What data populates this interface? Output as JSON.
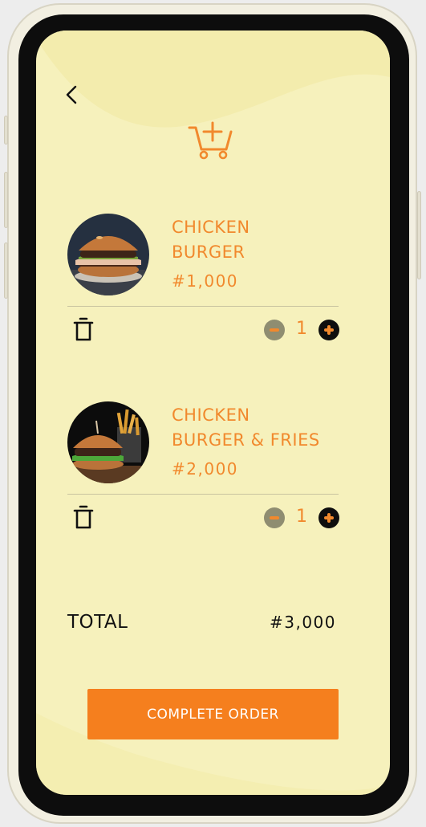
{
  "app": {
    "colors": {
      "background": "#f6f1bc",
      "accent": "#f1892d",
      "button": "#f57f1e",
      "text_dark": "#111111",
      "minus_button": "#8f8d71",
      "plus_button": "#0e0e0e"
    }
  },
  "header": {
    "back_icon": "chevron-left-icon",
    "cart_icon": "cart-add-icon"
  },
  "cart": {
    "items": [
      {
        "name_line1": "CHICKEN",
        "name_line2": "BURGER",
        "price": "#1,000",
        "quantity": "1",
        "image": "burger-photo",
        "delete_icon": "trash-icon"
      },
      {
        "name_line1": "CHICKEN",
        "name_line2": "BURGER & FRIES",
        "price": "#2,000",
        "quantity": "1",
        "image": "burger-and-fries-photo",
        "delete_icon": "trash-icon"
      }
    ]
  },
  "summary": {
    "total_label": "TOTAL",
    "total_value": "#3,000"
  },
  "actions": {
    "complete_order_label": "COMPLETE ORDER"
  }
}
